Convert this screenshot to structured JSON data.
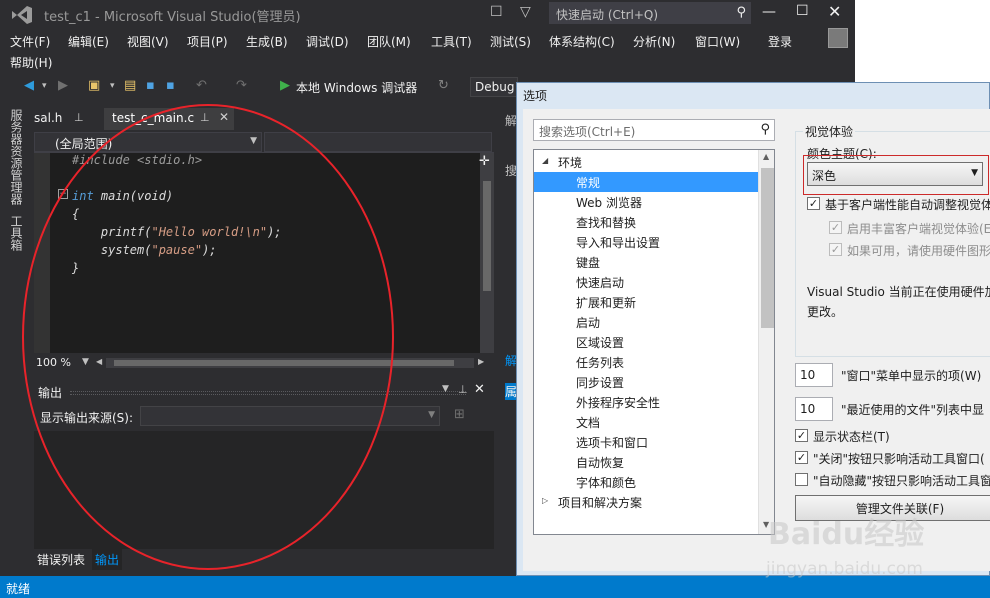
{
  "window": {
    "title": "test_c1 - Microsoft Visual Studio(管理员)",
    "quick_launch_placeholder": "快速启动 (Ctrl+Q)",
    "login": "登录"
  },
  "menu": {
    "items": [
      "文件(F)",
      "编辑(E)",
      "视图(V)",
      "项目(P)",
      "生成(B)",
      "调试(D)",
      "团队(M)",
      "工具(T)",
      "测试(S)",
      "体系结构(C)",
      "分析(N)",
      "窗口(W)"
    ],
    "help": "帮助(H)"
  },
  "toolbar": {
    "debugger_label": "本地 Windows 调试器",
    "config": "Debug"
  },
  "side_strip": {
    "server_explorer": "服务器资源管理器",
    "toolbox": "工具箱"
  },
  "doc_tabs": {
    "tab1": "sal.h",
    "tab2": "test_c_main.c"
  },
  "nav": {
    "scope": "(全局范围)"
  },
  "code": {
    "line1": "#include <stdio.h>",
    "line3_kw": "int",
    "line3_rest": " main(void)",
    "line4": "{",
    "line5_a": "    printf(",
    "line5_str": "\"Hello world!\\n\"",
    "line5_b": ");",
    "line6_a": "    system(",
    "line6_str": "\"pause\"",
    "line6_b": ");",
    "line7": "}"
  },
  "zoom": "100 %",
  "output": {
    "title": "输出",
    "source_label": "显示输出来源(S):",
    "source_value": ""
  },
  "bottom_tabs": {
    "errors": "错误列表",
    "output": "输出"
  },
  "status": "就绪",
  "bg_strip": {
    "c1": "解",
    "c2": "搜",
    "c3": "解",
    "c4": "属"
  },
  "options_dialog": {
    "title": "选项",
    "search_placeholder": "搜索选项(Ctrl+E)",
    "tree_root": "环境",
    "tree_items": [
      "常规",
      "Web 浏览器",
      "查找和替换",
      "导入和导出设置",
      "键盘",
      "快速启动",
      "扩展和更新",
      "启动",
      "区域设置",
      "任务列表",
      "同步设置",
      "外接程序安全性",
      "文档",
      "选项卡和窗口",
      "自动恢复",
      "字体和颜色"
    ],
    "tree_next_root": "项目和解决方案",
    "selected_index": 0,
    "group_title": "视觉体验",
    "color_theme_label": "颜色主题(C):",
    "color_theme_value": "深色",
    "chk_auto_adjust": "基于客户端性能自动调整视觉体验",
    "chk_rich": "启用丰富客户端视觉体验(E)",
    "chk_hw": "如果可用，请使用硬件图形加速",
    "hw_note_1": "Visual Studio 当前正在使用硬件加",
    "hw_note_2": "更改。",
    "window_menu_count": "10",
    "window_menu_label": "\"窗口\"菜单中显示的项(W)",
    "recent_count": "10",
    "recent_label": "\"最近使用的文件\"列表中显",
    "chk_statusbar": "显示状态栏(T)",
    "chk_close_active": "\"关闭\"按钮只影响活动工具窗口(",
    "chk_autohide": "\"自动隐藏\"按钮只影响活动工具窗",
    "manage_button": "管理文件关联(F)"
  },
  "watermark": {
    "brand": "Baidu经验",
    "url": "jingyan.baidu.com"
  },
  "colors": {
    "accent": "#007acc",
    "editor_bg": "#1e1e1e",
    "annotation": "#e8232a"
  }
}
